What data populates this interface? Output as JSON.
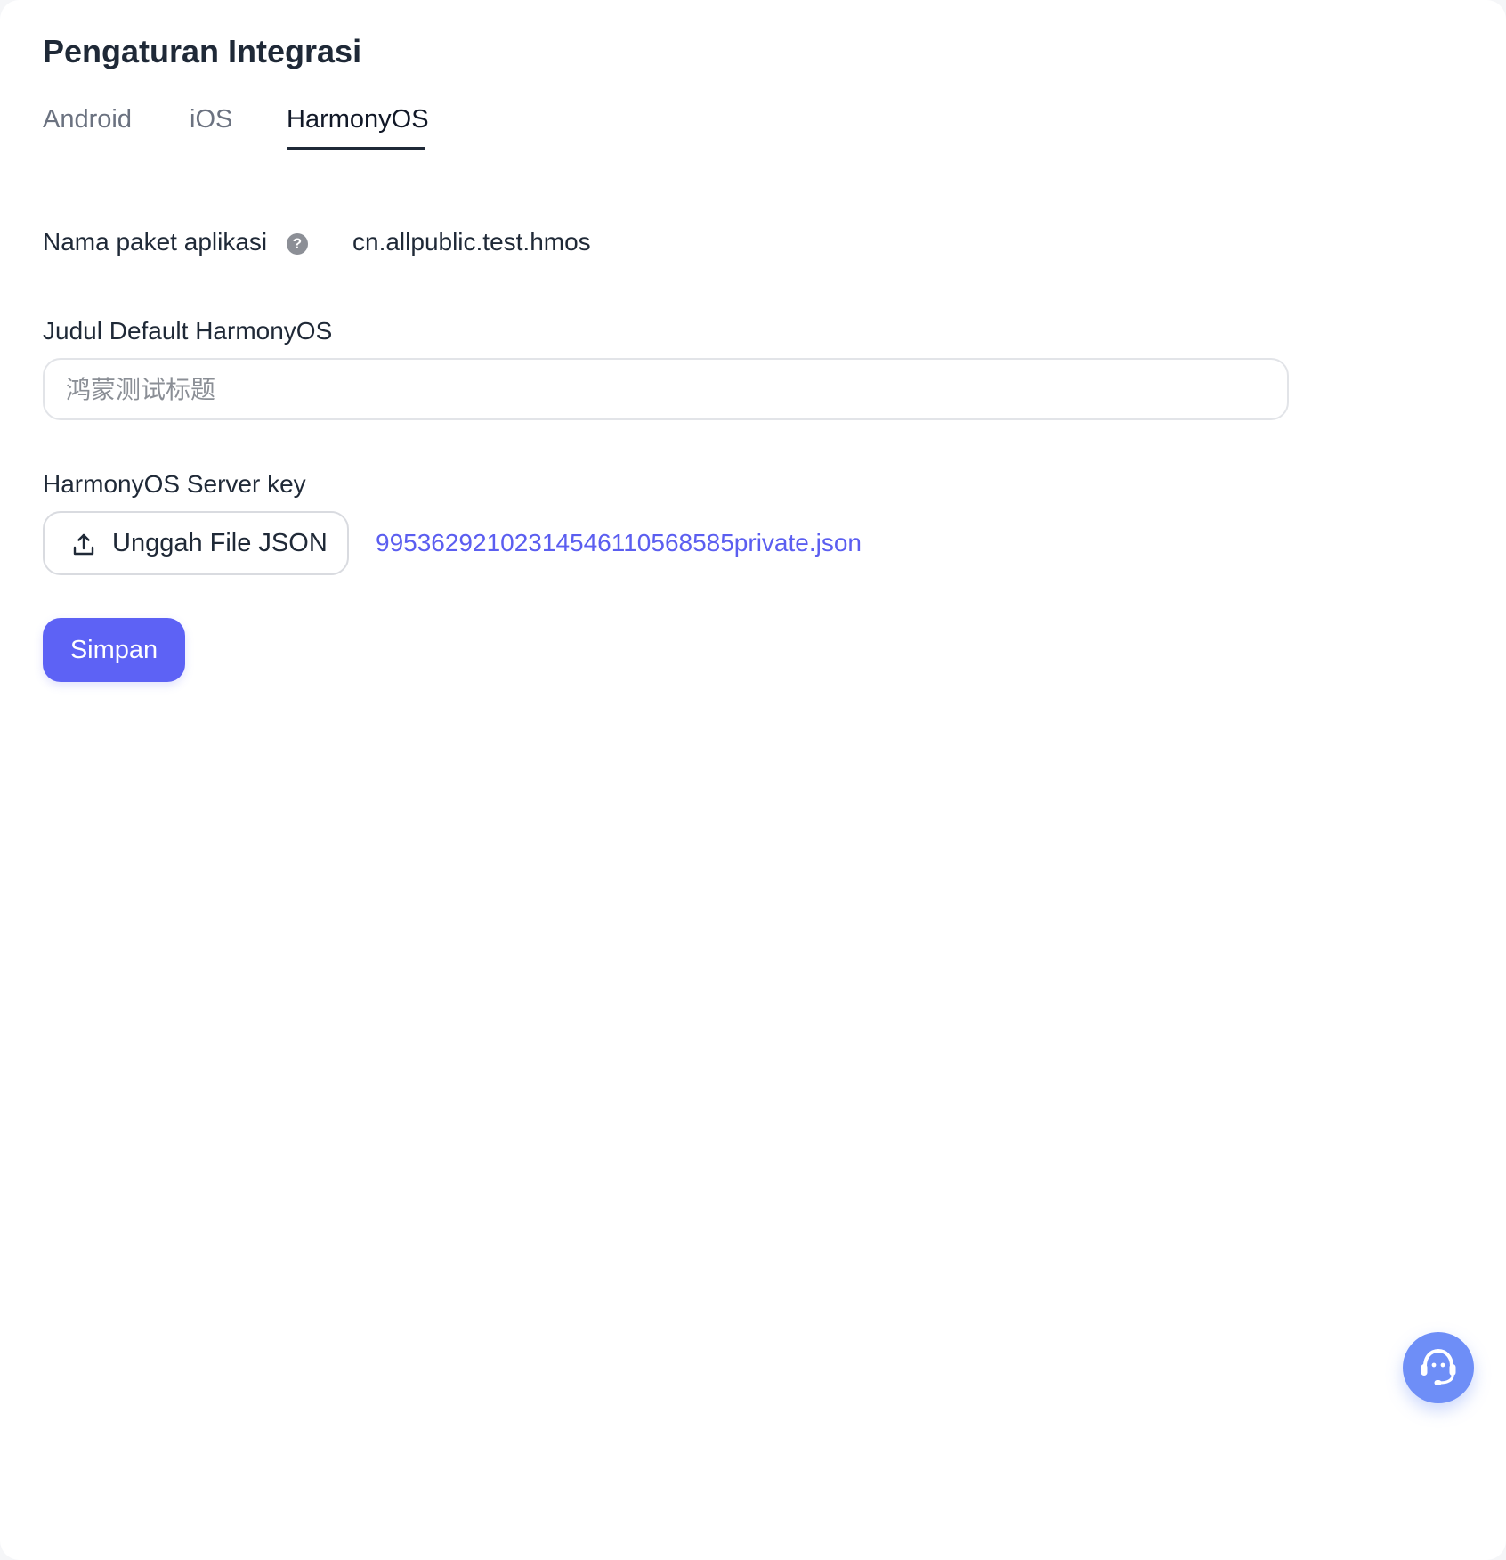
{
  "page": {
    "title": "Pengaturan Integrasi"
  },
  "tabs": [
    {
      "label": "Android",
      "active": false
    },
    {
      "label": "iOS",
      "active": false
    },
    {
      "label": "HarmonyOS",
      "active": true
    }
  ],
  "form": {
    "package_label": "Nama paket aplikasi",
    "package_value": "cn.allpublic.test.hmos",
    "default_title_label": "Judul Default HarmonyOS",
    "default_title_placeholder": "鸿蒙测试标题",
    "server_key_label": "HarmonyOS Server key",
    "upload_button_label": "Unggah File JSON",
    "uploaded_file_name": "995362921023145461105685​85private.json",
    "save_label": "Simpan"
  },
  "icons": {
    "help": "question-mark-icon",
    "upload": "upload-icon",
    "support": "headset-icon"
  },
  "colors": {
    "accent": "#5d62f5",
    "link": "#5b5ef0",
    "support_fab": "#6e8ef7"
  }
}
